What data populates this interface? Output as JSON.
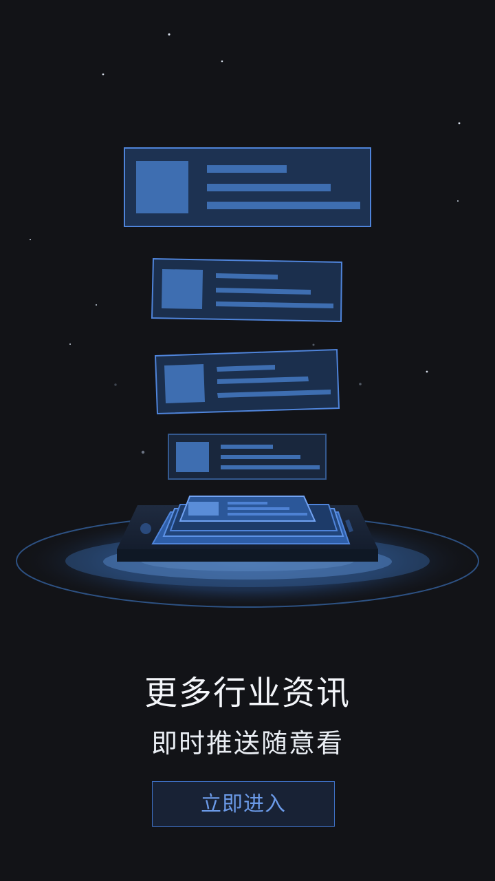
{
  "onboarding": {
    "title": "更多行业资讯",
    "subtitle": "即时推送随意看",
    "button_label": "立即进入"
  },
  "colors": {
    "background": "#121317",
    "card_fill": "#1d3252",
    "card_border": "#4f84da",
    "accent": "#4f84da",
    "button_text": "#6b9ae8"
  },
  "illustration": {
    "icon": "news-cards-over-phone-icon"
  }
}
